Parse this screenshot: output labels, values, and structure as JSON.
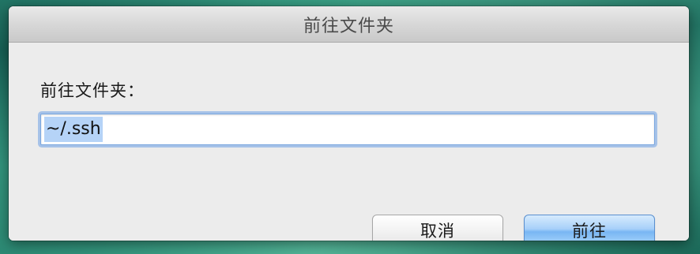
{
  "dialog": {
    "title": "前往文件夹",
    "prompt_label": "前往文件夹：",
    "path_input": {
      "value": "~/.ssh",
      "selected": true
    },
    "buttons": {
      "cancel_label": "取消",
      "go_label": "前往"
    }
  },
  "colors": {
    "accent": "#79b6f3",
    "selection": "#b5d3f7",
    "window_bg": "#ececec"
  }
}
